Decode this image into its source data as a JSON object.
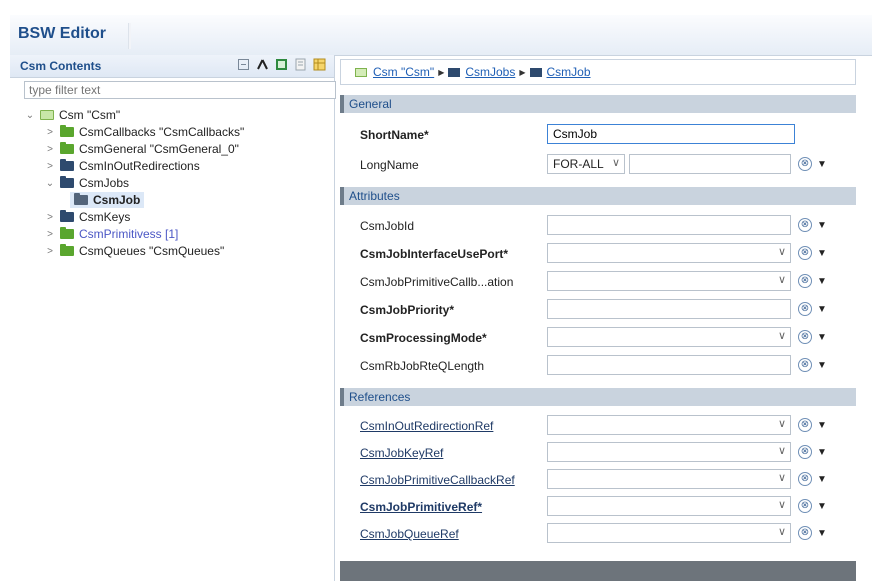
{
  "editor": {
    "title": "BSW Editor"
  },
  "contents": {
    "title": "Csm Contents",
    "filter_placeholder": "type filter text",
    "tools": [
      "collapse-all-icon",
      "hierarchy-icon",
      "excel-icon",
      "document-icon",
      "grid-icon"
    ],
    "tree": [
      {
        "label": "Csm \"Csm\"",
        "twisty": "⌄"
      },
      {
        "label": "CsmCallbacks \"CsmCallbacks\"",
        "twisty": ">"
      },
      {
        "label": "CsmGeneral \"CsmGeneral_0\"",
        "twisty": ">"
      },
      {
        "label": "CsmInOutRedirections",
        "twisty": ">"
      },
      {
        "label": "CsmJobs",
        "twisty": "⌄"
      },
      {
        "label": "CsmJob",
        "twisty": ""
      },
      {
        "label": "CsmKeys",
        "twisty": ">"
      },
      {
        "label": "CsmPrimitivess [1]",
        "twisty": ">"
      },
      {
        "label": "CsmQueues \"CsmQueues\"",
        "twisty": ">"
      }
    ]
  },
  "breadcrumb": {
    "items": [
      "Csm \"Csm\"",
      "CsmJobs",
      "CsmJob"
    ]
  },
  "general": {
    "title": "General",
    "shortname_label": "ShortName*",
    "shortname_value": "CsmJob",
    "longname_label": "LongName",
    "longname_lang": "FOR-ALL"
  },
  "attributes": {
    "title": "Attributes",
    "rows": [
      "CsmJobId",
      "CsmJobInterfaceUsePort*",
      "CsmJobPrimitiveCallb...ation",
      "CsmJobPriority*",
      "CsmProcessingMode*",
      "CsmRbJobRteQLength"
    ]
  },
  "references": {
    "title": "References",
    "rows": [
      "CsmInOutRedirectionRef",
      "CsmJobKeyRef",
      "CsmJobPrimitiveCallbackRef",
      "CsmJobPrimitiveRef*",
      "CsmJobQueueRef"
    ]
  },
  "colors": {
    "accent": "#1f4f8b",
    "section_bg": "#c9d3de",
    "folder_green": "#5aa62e",
    "folder_navy": "#2e4a6e",
    "link_purple": "#4b57c5"
  }
}
